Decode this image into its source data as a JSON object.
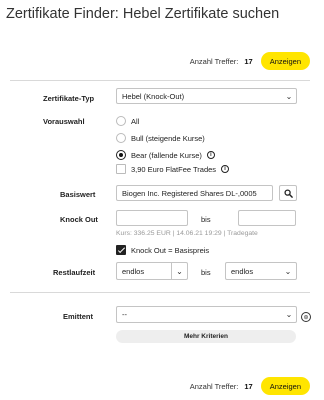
{
  "page": {
    "title": "Zertifikate Finder: Hebel Zertifikate suchen"
  },
  "results": {
    "label": "Anzahl Treffer:",
    "count": "17",
    "button_label": "Anzeigen"
  },
  "form": {
    "type": {
      "label": "Zertifikate-Typ",
      "value": "Hebel (Knock-Out)"
    },
    "preselection": {
      "label": "Vorauswahl",
      "options": [
        "All",
        "Bull (steigende Kurse)",
        "Bear (fallende Kurse)"
      ],
      "selected": "Bear (fallende Kurse)",
      "flatfee_label": "3,90 Euro FlatFee Trades"
    },
    "underlying": {
      "label": "Basiswert",
      "value": "Biogen Inc. Registered Shares DL-,0005"
    },
    "knockout": {
      "label": "Knock Out",
      "from": "",
      "to": "",
      "bis_label": "bis",
      "hint": "Kurs: 336.25 EUR | 14.06.21 19:29 | Tradegate",
      "checkbox_label": "Knock Out = Basispreis"
    },
    "maturity": {
      "label": "Restlaufzeit",
      "from": "endlos",
      "to": "endlos",
      "bis_label": "bis"
    },
    "issuer": {
      "label": "Emittent",
      "value": "--"
    },
    "more_criteria_label": "Mehr Kriterien"
  }
}
